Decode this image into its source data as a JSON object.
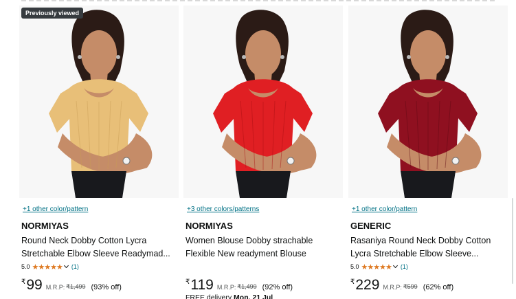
{
  "colors": {
    "link": "#007185",
    "star": "#de7921",
    "text": "#0f1111",
    "muted": "#565959",
    "badge_bg": "#363b3f"
  },
  "products": [
    {
      "badge": "Previously viewed",
      "variant_link": "+1 other color/pattern",
      "brand": "NORMIYAS",
      "title_line_1": "Round Neck Dobby Cotton Lycra",
      "title_line_2": "Stretchable Elbow Sleeve Readymad...",
      "rating": "5.0",
      "stars": "★★★★★",
      "review_count": "(1)",
      "currency": "₹",
      "price": "99",
      "mrp_label": "M.R.P:",
      "mrp": "₹1,499",
      "discount": "(93% off)",
      "blouse_color": "#e8bf78",
      "blouse_shadow": "#c99d55"
    },
    {
      "variant_link": "+3 other colors/patterns",
      "brand": "NORMIYAS",
      "title_line_1": "Women Blouse Dobby strachable",
      "title_line_2": "Flexible New readyment Blouse",
      "currency": "₹",
      "price": "119",
      "mrp_label": "M.R.P:",
      "mrp": "₹1,499",
      "discount": "(92% off)",
      "delivery_prefix": "FREE delivery ",
      "delivery_date": "Mon, 21 Jul",
      "blouse_color": "#e01f23",
      "blouse_shadow": "#a90f13"
    },
    {
      "variant_link": "+1 other color/pattern",
      "brand": "GENERIC",
      "title_line_1": "Rasaniya Round Neck Dobby Cotton",
      "title_line_2": "Lycra Stretchable Elbow Sleeve...",
      "rating": "5.0",
      "stars": "★★★★★",
      "review_count": "(1)",
      "currency": "₹",
      "price": "229",
      "mrp_label": "M.R.P:",
      "mrp": "₹599",
      "discount": "(62% off)",
      "blouse_color": "#8f1020",
      "blouse_shadow": "#5d0812"
    }
  ]
}
